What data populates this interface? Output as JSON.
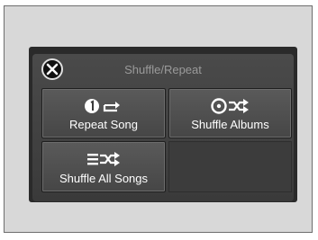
{
  "popup": {
    "title": "Shuffle/Repeat",
    "close_icon": "close-icon"
  },
  "options": [
    {
      "label": "Repeat Song",
      "icon": "repeat-one-icon"
    },
    {
      "label": "Shuffle Albums",
      "icon": "shuffle-albums-icon"
    },
    {
      "label": "Shuffle All Songs",
      "icon": "shuffle-all-icon"
    }
  ],
  "colors": {
    "background": "#d8d8d8",
    "popup": "#3a3a3a",
    "button": "#4f4f4f",
    "title_text": "#9a9a9a",
    "label_text": "#ffffff"
  }
}
